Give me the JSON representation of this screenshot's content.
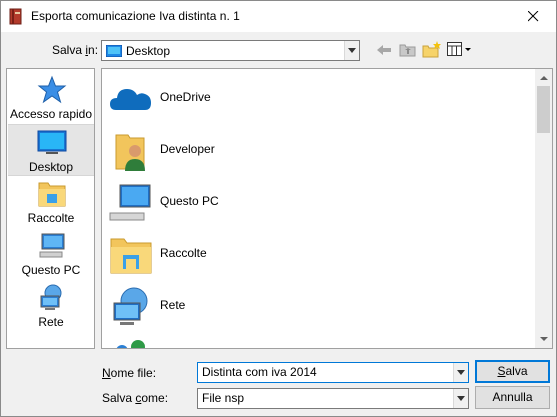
{
  "window": {
    "title": "Esporta comunicazione Iva distinta n. 1"
  },
  "header": {
    "save_in_label_prefix": "Salva ",
    "save_in_label_accel": "i",
    "save_in_label_suffix": "n:",
    "location": "Desktop"
  },
  "places": [
    {
      "label": "Accesso rapido",
      "icon": "star-icon"
    },
    {
      "label": "Desktop",
      "icon": "desktop-icon",
      "selected": true
    },
    {
      "label": "Raccolte",
      "icon": "library-folder-icon"
    },
    {
      "label": "Questo PC",
      "icon": "computer-icon"
    },
    {
      "label": "Rete",
      "icon": "network-icon"
    }
  ],
  "files": [
    {
      "name": "OneDrive",
      "icon": "cloud-icon"
    },
    {
      "name": "Developer",
      "icon": "user-folder-icon"
    },
    {
      "name": "Questo PC",
      "icon": "computer-icon"
    },
    {
      "name": "Raccolte",
      "icon": "library-folder-icon"
    },
    {
      "name": "Rete",
      "icon": "network-icon"
    }
  ],
  "form": {
    "filename_label_accel": "N",
    "filename_label_rest": "ome file:",
    "filename_value": "Distinta com iva 2014",
    "savetype_label_prefix": "Salva ",
    "savetype_label_accel": "c",
    "savetype_label_rest": "ome:",
    "savetype_value": "File nsp"
  },
  "buttons": {
    "save_accel": "S",
    "save_rest": "alva",
    "cancel": "Annulla"
  },
  "colors": {
    "accent": "#0078d7",
    "selection": "#e5e5e5"
  }
}
